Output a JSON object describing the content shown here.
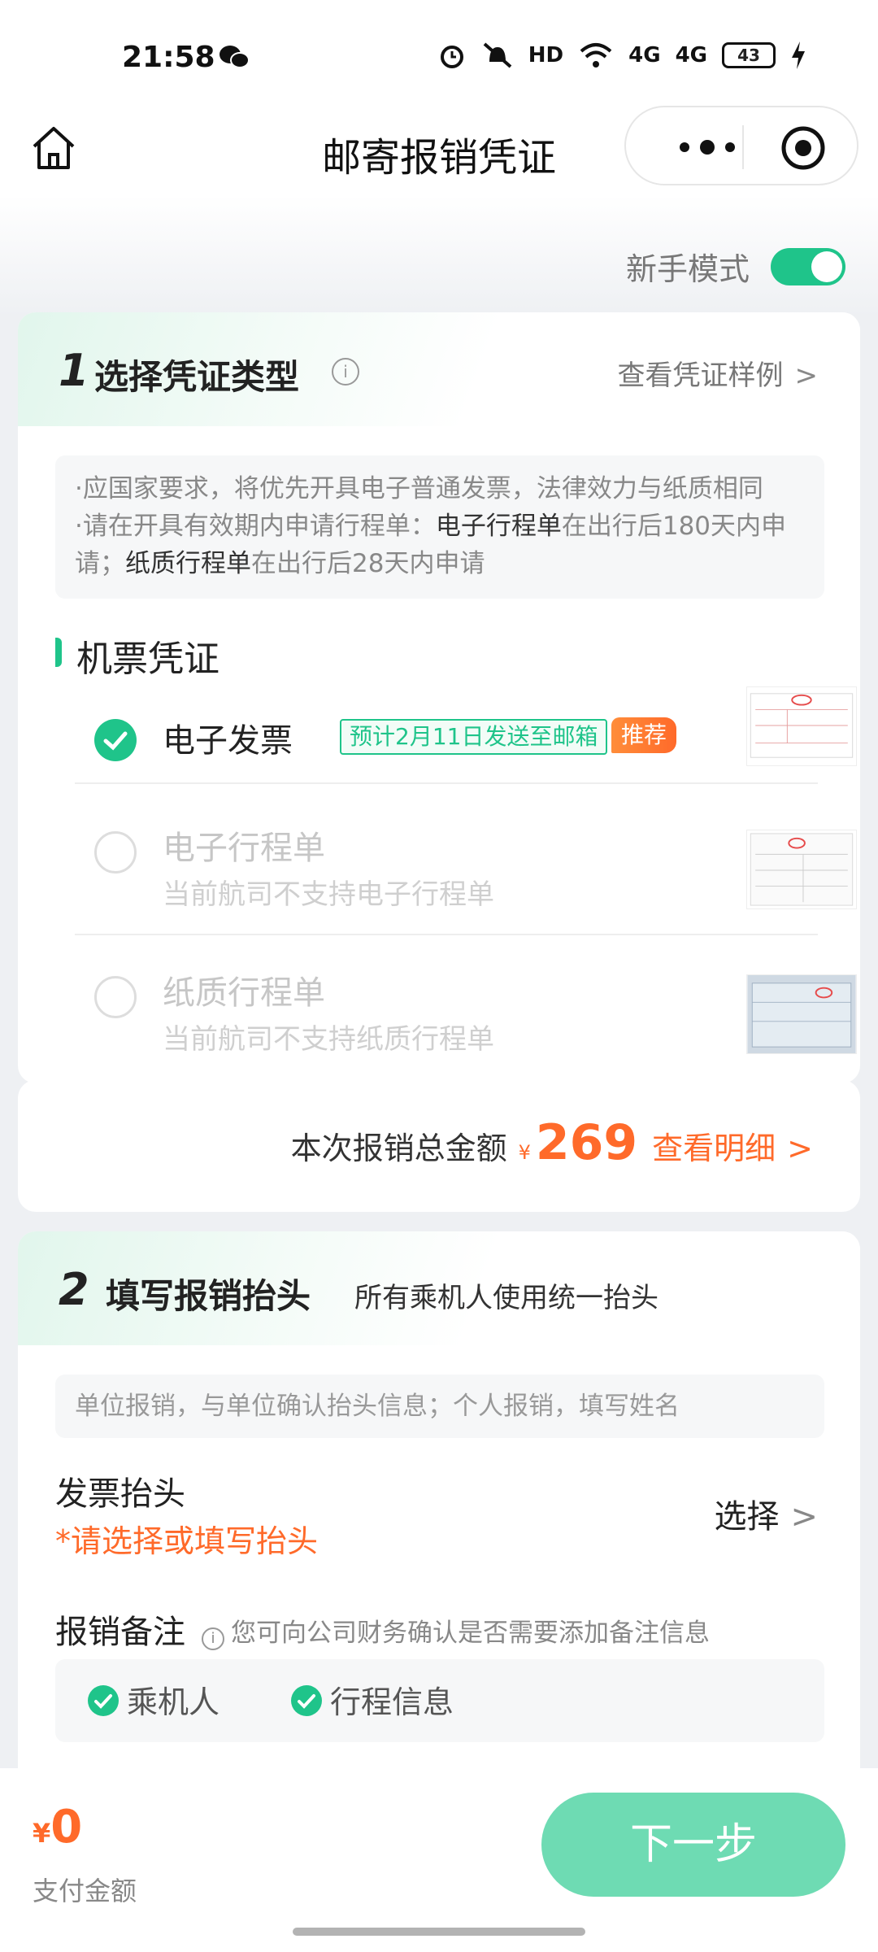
{
  "status_bar": {
    "time": "21:58",
    "hd": "HD",
    "net1": "4G",
    "net2": "4G",
    "battery": "43"
  },
  "nav": {
    "title": "邮寄报销凭证"
  },
  "mode": {
    "label": "新手模式",
    "enabled": true
  },
  "section1": {
    "number": "1",
    "title": "选择凭证类型",
    "sample_link": "查看凭证样例",
    "notice": [
      {
        "text": "·应国家要求，将优先开具电子普通发票，法律效力与纸质相同"
      },
      {
        "text_prefix": "·请在开具有效期内申请行程单：",
        "bold1": "电子行程单",
        "text_mid": "在出行后180天内申请；",
        "bold2": "纸质行程单",
        "text_suffix": "在出行后28天内申请"
      }
    ],
    "sub_title": "机票凭证",
    "options": [
      {
        "label": "电子发票",
        "tag": "预计2月11日发送至邮箱",
        "badge": "推荐",
        "selected": true
      },
      {
        "label": "电子行程单",
        "sub": "当前航司不支持电子行程单",
        "selected": false
      },
      {
        "label": "纸质行程单",
        "sub": "当前航司不支持纸质行程单",
        "selected": false
      }
    ]
  },
  "amount": {
    "label": "本次报销总金额",
    "currency": "¥",
    "value": "269",
    "detail": "查看明细"
  },
  "section2": {
    "number": "2",
    "title": "填写报销抬头",
    "desc": "所有乘机人使用统一抬头",
    "hint": "单位报销，与单位确认抬头信息；个人报销，填写姓名",
    "invoice_title_label": "发票抬头",
    "invoice_title_required": "*请选择或填写抬头",
    "select_label": "选择",
    "note_label": "报销备注",
    "note_hint": "您可向公司财务确认是否需要添加备注信息",
    "note_checks": [
      "乘机人",
      "行程信息"
    ]
  },
  "bottom": {
    "currency": "¥",
    "pay_value": "0",
    "pay_label": "支付金额",
    "next_label": "下一步"
  },
  "colors": {
    "accent": "#1fc48a",
    "orange": "#ff6a2a",
    "button": "#6edbb3"
  }
}
